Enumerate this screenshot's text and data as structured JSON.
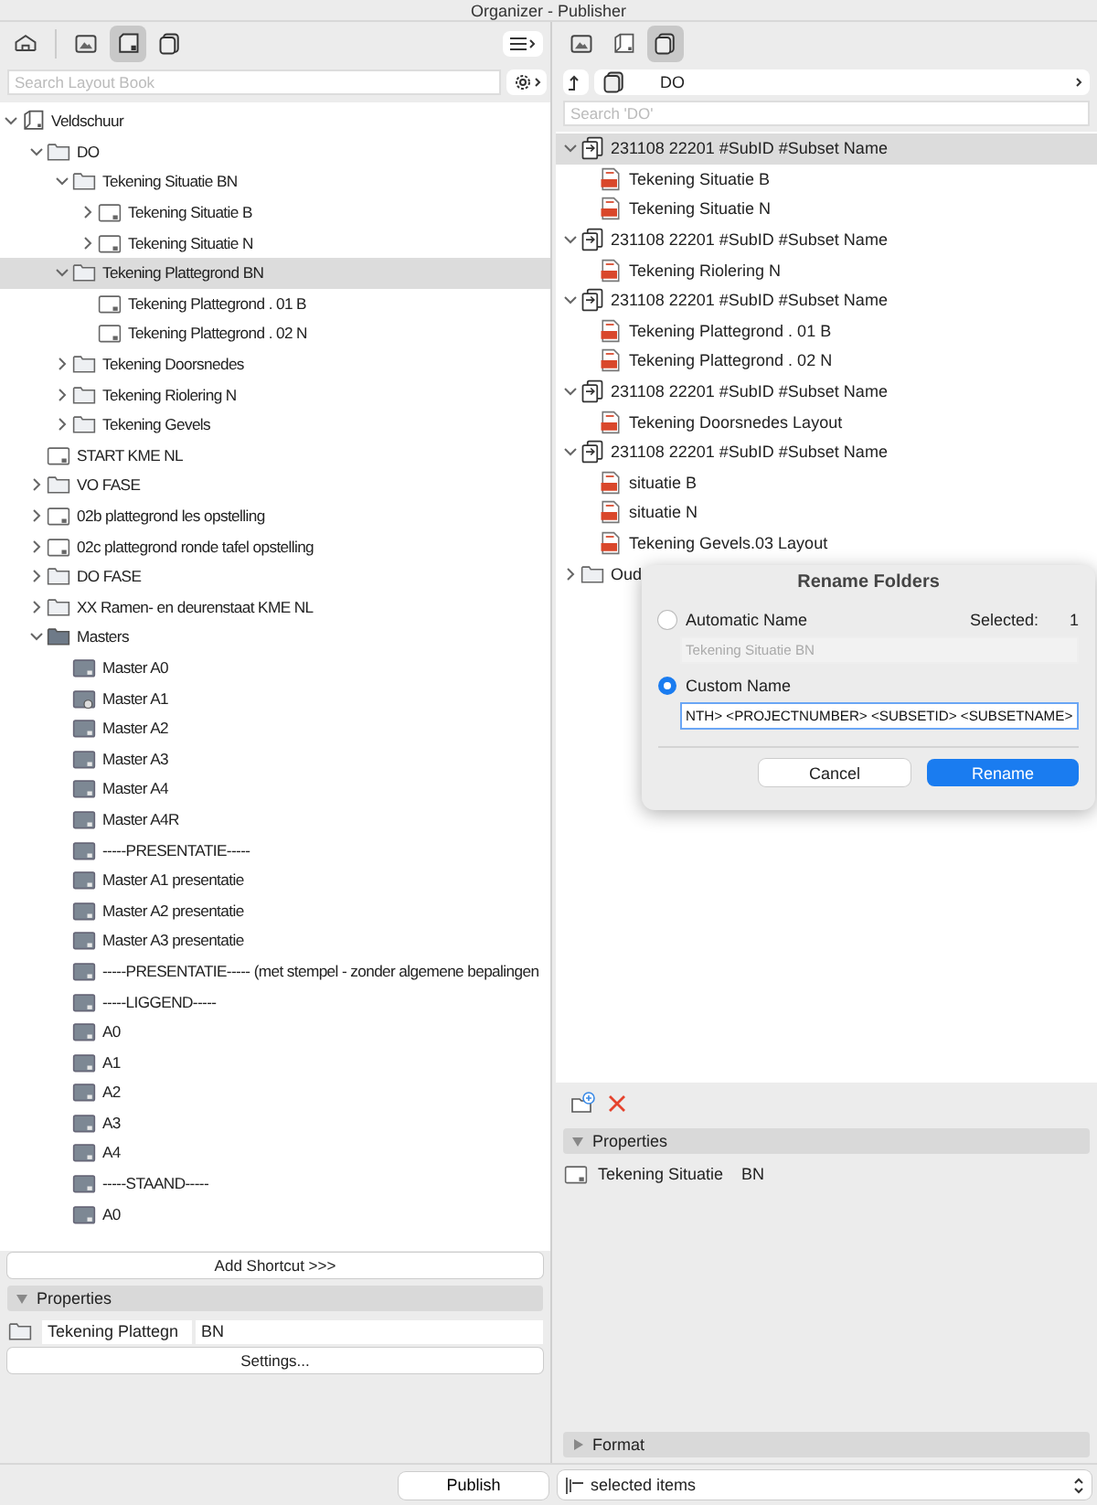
{
  "window": {
    "title": "Organizer - Publisher"
  },
  "left_panel": {
    "toolbar": [
      {
        "kind": "roof",
        "selected": false
      },
      {
        "kind": "frame",
        "selected": false
      },
      {
        "kind": "sheet",
        "selected": true
      },
      {
        "kind": "stack",
        "selected": false
      }
    ],
    "search": {
      "placeholder": "Search Layout Book"
    },
    "tree": [
      {
        "label": "Veldschuur",
        "kind": "book",
        "expanded": true,
        "selected": false,
        "children": [
          {
            "label": "DO",
            "kind": "folder",
            "expanded": true,
            "selected": false,
            "children": [
              {
                "label": "Tekening Situatie BN",
                "kind": "folder",
                "expanded": true,
                "selected": false,
                "children": [
                  {
                    "label": "Tekening Situatie B",
                    "kind": "layout",
                    "expanded": false,
                    "selected": false
                  },
                  {
                    "label": "Tekening Situatie N",
                    "kind": "layout",
                    "expanded": false,
                    "selected": false
                  }
                ]
              },
              {
                "label": "Tekening Plattegrond BN",
                "kind": "folder",
                "expanded": true,
                "selected": true,
                "children": [
                  {
                    "label": "Tekening Plattegrond . 01 B",
                    "kind": "layout",
                    "selected": false
                  },
                  {
                    "label": "Tekening Plattegrond . 02 N",
                    "kind": "layout",
                    "selected": false
                  }
                ]
              },
              {
                "label": "Tekening Doorsnedes",
                "kind": "folder",
                "expanded": false,
                "selected": false
              },
              {
                "label": "Tekening Riolering N",
                "kind": "folder",
                "expanded": false,
                "selected": false
              },
              {
                "label": "Tekening Gevels",
                "kind": "folder",
                "expanded": false,
                "selected": false
              }
            ]
          },
          {
            "label": "START KME NL",
            "kind": "layout",
            "selected": false
          },
          {
            "label": "VO FASE",
            "kind": "folder",
            "expanded": false,
            "selected": false
          },
          {
            "label": "02b plattegrond les opstelling",
            "kind": "layout",
            "expanded": false,
            "selected": false
          },
          {
            "label": "02c plattegrond ronde tafel opstelling",
            "kind": "layout",
            "expanded": false,
            "selected": false
          },
          {
            "label": "DO FASE",
            "kind": "folder",
            "expanded": false,
            "selected": false
          },
          {
            "label": "XX Ramen- en deurenstaat KME NL",
            "kind": "folder",
            "expanded": false,
            "selected": false
          },
          {
            "label": "Masters",
            "kind": "master-folder",
            "expanded": true,
            "selected": false,
            "children": [
              {
                "label": "Master A0",
                "kind": "master",
                "selected": false
              },
              {
                "label": "Master A1",
                "kind": "master-linked",
                "selected": false
              },
              {
                "label": "Master A2",
                "kind": "master",
                "selected": false
              },
              {
                "label": "Master A3",
                "kind": "master",
                "selected": false
              },
              {
                "label": "Master A4",
                "kind": "master",
                "selected": false
              },
              {
                "label": "Master A4R",
                "kind": "master",
                "selected": false
              },
              {
                "label": "-----PRESENTATIE-----",
                "kind": "master",
                "selected": false
              },
              {
                "label": "Master A1 presentatie",
                "kind": "master",
                "selected": false
              },
              {
                "label": "Master A2 presentatie",
                "kind": "master",
                "selected": false
              },
              {
                "label": "Master A3 presentatie",
                "kind": "master",
                "selected": false
              },
              {
                "label": "-----PRESENTATIE----- (met stempel - zonder algemene bepalingen",
                "kind": "master",
                "selected": false
              },
              {
                "label": "-----LIGGEND-----",
                "kind": "master",
                "selected": false
              },
              {
                "label": "A0",
                "kind": "master",
                "selected": false
              },
              {
                "label": "A1",
                "kind": "master",
                "selected": false
              },
              {
                "label": "A2",
                "kind": "master",
                "selected": false
              },
              {
                "label": "A3",
                "kind": "master",
                "selected": false
              },
              {
                "label": "A4",
                "kind": "master",
                "selected": false
              },
              {
                "label": "-----STAAND-----",
                "kind": "master",
                "selected": false
              },
              {
                "label": "A0",
                "kind": "master",
                "selected": false
              }
            ]
          }
        ]
      }
    ],
    "add_shortcut": "Add Shortcut >>>",
    "properties": {
      "title": "Properties",
      "expanded": true,
      "name": "Tekening Plattegn",
      "id": "BN"
    },
    "settings": "Settings...",
    "publish": "Publish"
  },
  "right_panel": {
    "toolbar": [
      {
        "kind": "frame",
        "selected": false
      },
      {
        "kind": "book",
        "selected": false
      },
      {
        "kind": "stack",
        "selected": true
      }
    ],
    "path": "DO",
    "search": {
      "placeholder": "Search 'DO'"
    },
    "tree": [
      {
        "label": "231108 22201 #SubID #Subset Name",
        "kind": "set",
        "expanded": true,
        "selected": true,
        "children": [
          {
            "label": "Tekening Situatie B",
            "kind": "pdf",
            "selected": false
          },
          {
            "label": "Tekening Situatie N",
            "kind": "pdf",
            "selected": false
          }
        ]
      },
      {
        "label": "231108 22201 #SubID #Subset Name",
        "kind": "set",
        "expanded": true,
        "selected": false,
        "children": [
          {
            "label": "Tekening Riolering N",
            "kind": "pdf",
            "selected": false
          }
        ]
      },
      {
        "label": "231108 22201 #SubID #Subset Name",
        "kind": "set",
        "expanded": true,
        "selected": false,
        "children": [
          {
            "label": "Tekening Plattegrond . 01 B",
            "kind": "pdf",
            "selected": false
          },
          {
            "label": "Tekening Plattegrond . 02 N",
            "kind": "pdf",
            "selected": false
          }
        ]
      },
      {
        "label": "231108 22201 #SubID #Subset Name",
        "kind": "set",
        "expanded": true,
        "selected": false,
        "children": [
          {
            "label": "Tekening Doorsnedes Layout",
            "kind": "pdf",
            "selected": false
          }
        ]
      },
      {
        "label": "231108 22201 #SubID #Subset Name",
        "kind": "set",
        "expanded": true,
        "selected": false,
        "children": [
          {
            "label": "situatie B",
            "kind": "pdf",
            "selected": false
          },
          {
            "label": "situatie N",
            "kind": "pdf",
            "selected": false
          },
          {
            "label": "Tekening Gevels.03 Layout",
            "kind": "pdf",
            "selected": false
          }
        ]
      },
      {
        "label": "Oud",
        "kind": "folder",
        "expanded": false,
        "selected": false
      }
    ],
    "properties": {
      "title": "Properties",
      "expanded": true,
      "name": "Tekening Situatie",
      "id": "BN"
    },
    "format": {
      "title": "Format",
      "expanded": false
    },
    "publish_scope": "selected items"
  },
  "dialog": {
    "title": "Rename Folders",
    "selected_label": "Selected:",
    "selected_count": "1",
    "options": [
      {
        "label": "Automatic Name",
        "selected": false,
        "value": "Tekening Situatie BN"
      },
      {
        "label": "Custom Name",
        "selected": true,
        "value": "NTH> <PROJECTNUMBER> <SUBSETID> <SUBSETNAME>"
      }
    ],
    "buttons": [
      {
        "label": "Cancel",
        "kind": "secondary"
      },
      {
        "label": "Rename",
        "kind": "primary"
      }
    ]
  }
}
